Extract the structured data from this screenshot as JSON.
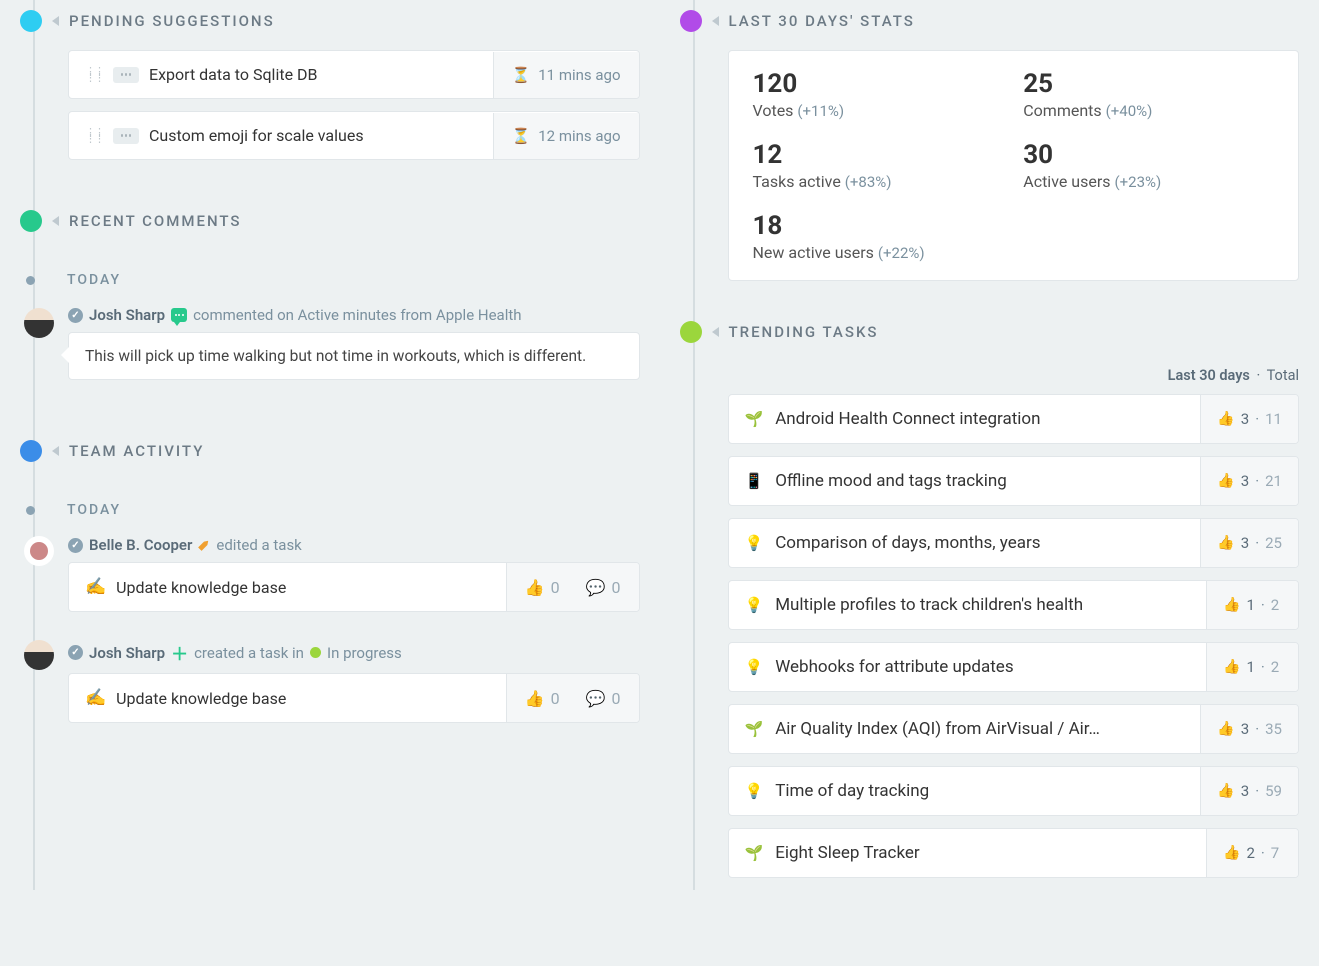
{
  "pending_suggestions": {
    "title": "PENDING SUGGESTIONS",
    "items": [
      {
        "text": "Export data to Sqlite DB",
        "time": "11 mins ago"
      },
      {
        "text": "Custom emoji for scale values",
        "time": "12 mins ago"
      }
    ]
  },
  "recent_comments": {
    "title": "RECENT COMMENTS",
    "date_label": "TODAY",
    "author": "Josh Sharp",
    "action_text": "commented on Active minutes from Apple Health",
    "comment": "This will pick up time walking but not time in workouts, which is different."
  },
  "team_activity": {
    "title": "TEAM ACTIVITY",
    "date_label": "TODAY",
    "items": [
      {
        "author": "Belle B. Cooper",
        "action": "edited a task",
        "task_text": "Update knowledge base",
        "likes": "0",
        "comments": "0",
        "icon": "pencil"
      },
      {
        "author": "Josh Sharp",
        "action": "created a task in",
        "status_label": "In progress",
        "task_text": "Update knowledge base",
        "likes": "0",
        "comments": "0",
        "icon": "plus"
      }
    ]
  },
  "stats": {
    "title": "LAST 30 DAYS' STATS",
    "items": [
      {
        "value": "120",
        "label": "Votes",
        "delta": "(+11%)"
      },
      {
        "value": "25",
        "label": "Comments",
        "delta": "(+40%)"
      },
      {
        "value": "12",
        "label": "Tasks active",
        "delta": "(+83%)"
      },
      {
        "value": "30",
        "label": "Active users",
        "delta": "(+23%)"
      },
      {
        "value": "18",
        "label": "New active users",
        "delta": "(+22%)"
      }
    ]
  },
  "trending": {
    "title": "TRENDING TASKS",
    "filter_active": "Last 30 days",
    "filter_other": "Total",
    "items": [
      {
        "emoji": "🌱",
        "text": "Android Health Connect integration",
        "recent": "3",
        "total": "11"
      },
      {
        "emoji": "📱",
        "text": "Offline mood and tags tracking",
        "recent": "3",
        "total": "21"
      },
      {
        "emoji": "💡",
        "text": "Comparison of days, months, years",
        "recent": "3",
        "total": "25"
      },
      {
        "emoji": "💡",
        "text": "Multiple profiles to track children's health",
        "recent": "1",
        "total": "2"
      },
      {
        "emoji": "💡",
        "text": "Webhooks for attribute updates",
        "recent": "1",
        "total": "2"
      },
      {
        "emoji": "🌱",
        "text": "Air Quality Index (AQI) from AirVisual / Air…",
        "recent": "3",
        "total": "35"
      },
      {
        "emoji": "💡",
        "text": "Time of day tracking",
        "recent": "3",
        "total": "59"
      },
      {
        "emoji": "🌱",
        "text": "Eight Sleep Tracker",
        "recent": "2",
        "total": "7"
      }
    ]
  }
}
